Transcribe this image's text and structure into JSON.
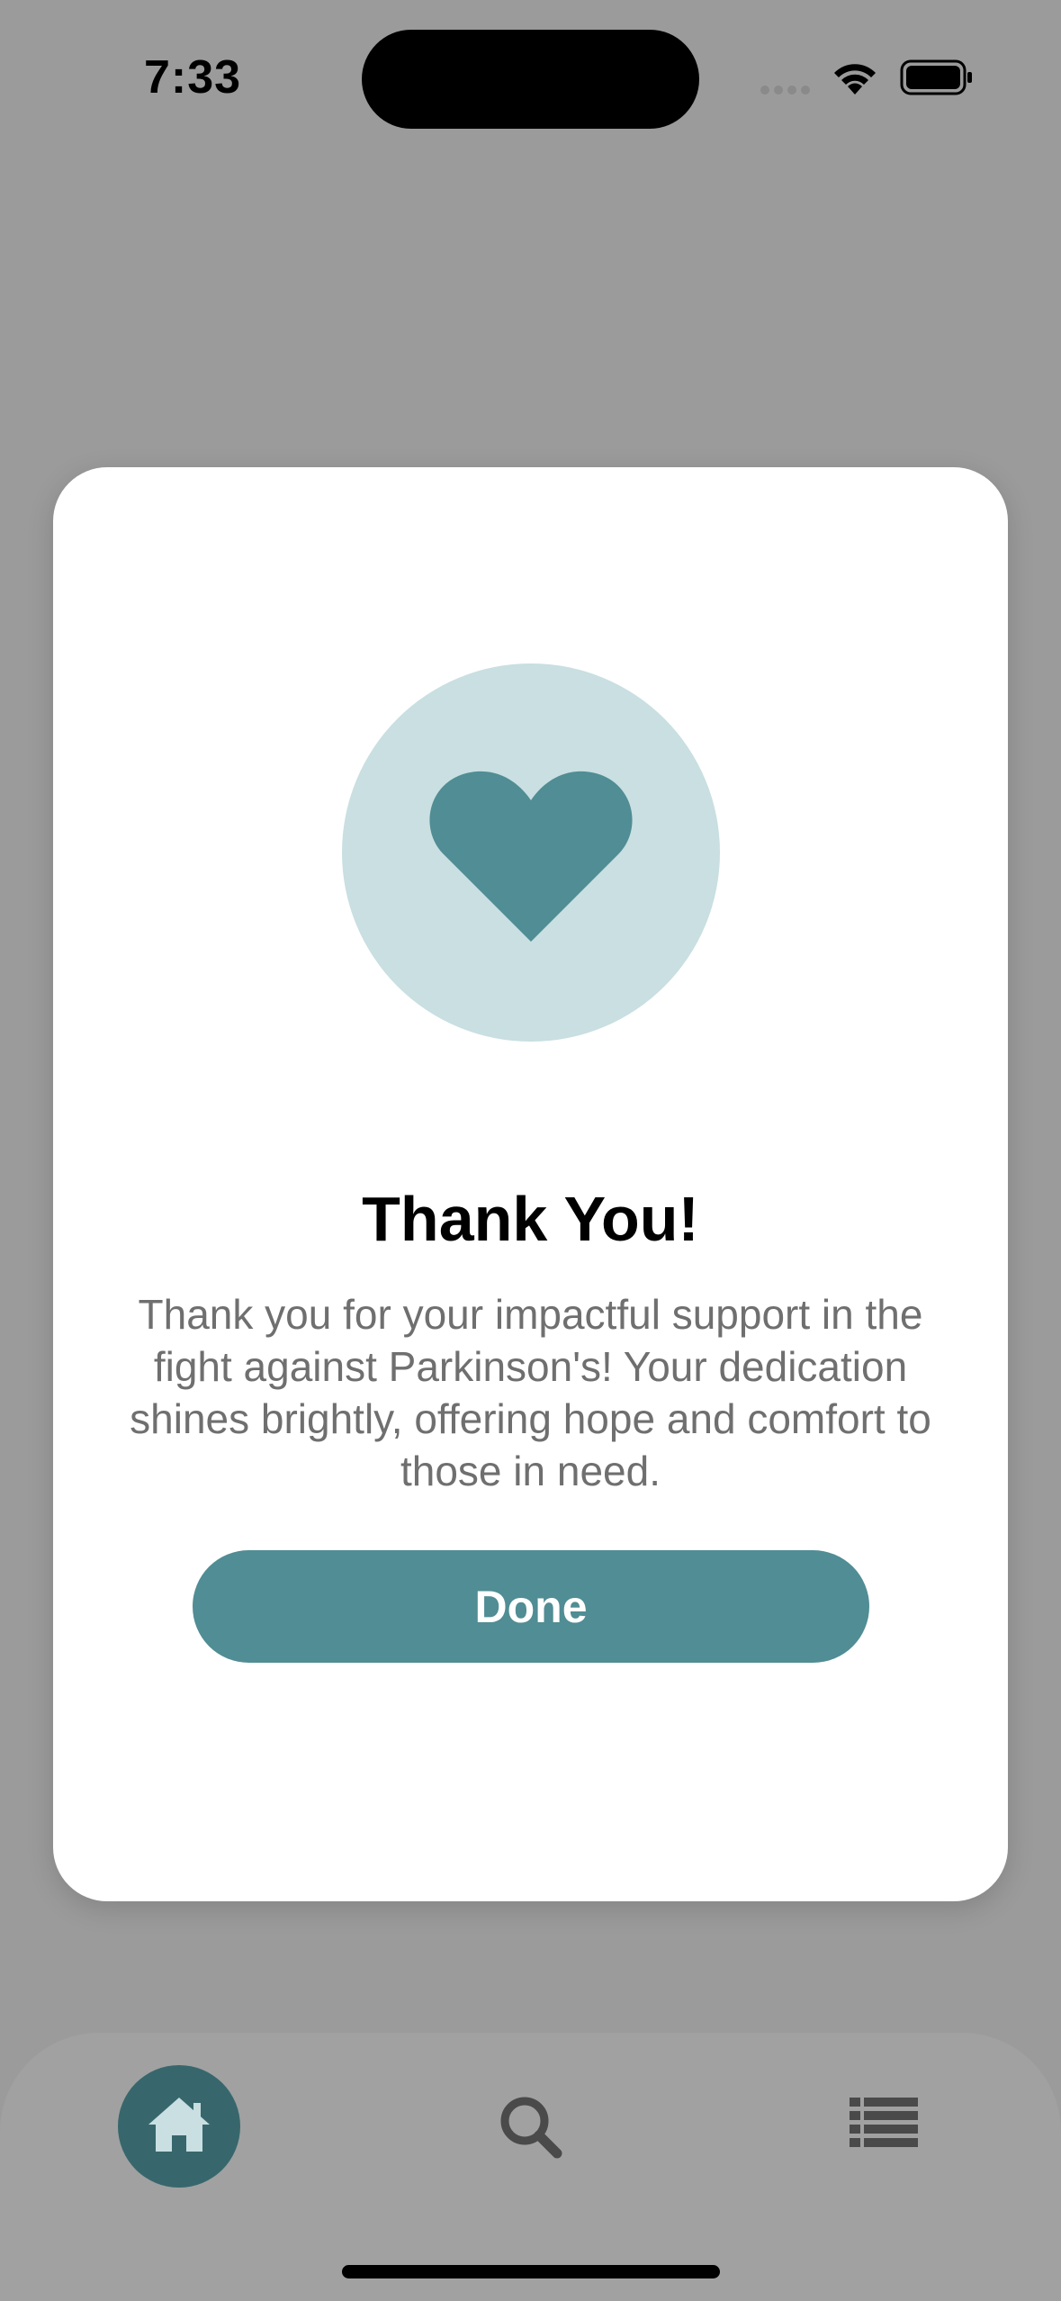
{
  "status_bar": {
    "time": "7:33"
  },
  "modal": {
    "icon": "heart-icon",
    "title": "Thank You!",
    "message": "Thank you for your impactful support in the fight against Parkinson's! Your dedication shines brightly, offering hope and comfort to those in need.",
    "done_label": "Done"
  },
  "tab_bar": {
    "items": [
      {
        "icon": "home-icon",
        "active": true
      },
      {
        "icon": "search-icon",
        "active": false
      },
      {
        "icon": "list-icon",
        "active": false
      }
    ]
  },
  "colors": {
    "accent": "#508d94",
    "accent_light": "#c9dfe1",
    "active_tab": "#37676c",
    "overlay_background": "#9b9b9b"
  }
}
